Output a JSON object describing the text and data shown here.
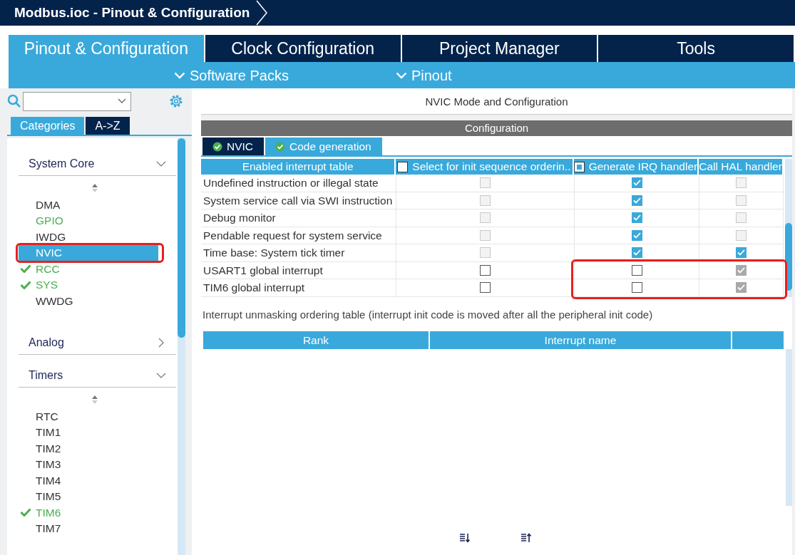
{
  "window": {
    "title": "Modbus.ioc - Pinout & Configuration"
  },
  "main_tabs": [
    {
      "label": "Pinout & Configuration",
      "selected": true
    },
    {
      "label": "Clock Configuration",
      "selected": false
    },
    {
      "label": "Project Manager",
      "selected": false
    },
    {
      "label": "Tools",
      "selected": false
    }
  ],
  "sub_menu": [
    "Software Packs",
    "Pinout"
  ],
  "sidebar": {
    "view_tabs": [
      {
        "label": "Categories",
        "selected": true
      },
      {
        "label": "A->Z",
        "selected": false
      }
    ],
    "categories": [
      {
        "label": "System Core",
        "expanded": true,
        "items": [
          {
            "label": "DMA",
            "configured": false,
            "checked": false,
            "selected": false,
            "annotated": false
          },
          {
            "label": "GPIO",
            "configured": true,
            "checked": false,
            "selected": false,
            "annotated": false
          },
          {
            "label": "IWDG",
            "configured": false,
            "checked": false,
            "selected": false,
            "annotated": false
          },
          {
            "label": "NVIC",
            "configured": false,
            "checked": false,
            "selected": true,
            "annotated": true
          },
          {
            "label": "RCC",
            "configured": true,
            "checked": true,
            "selected": false,
            "annotated": false
          },
          {
            "label": "SYS",
            "configured": true,
            "checked": true,
            "selected": false,
            "annotated": false
          },
          {
            "label": "WWDG",
            "configured": false,
            "checked": false,
            "selected": false,
            "annotated": false
          }
        ]
      },
      {
        "label": "Analog",
        "expanded": false
      },
      {
        "label": "Timers",
        "expanded": true,
        "items": [
          {
            "label": "RTC",
            "configured": false,
            "checked": false,
            "selected": false,
            "annotated": false
          },
          {
            "label": "TIM1",
            "configured": false,
            "checked": false,
            "selected": false,
            "annotated": false
          },
          {
            "label": "TIM2",
            "configured": false,
            "checked": false,
            "selected": false,
            "annotated": false
          },
          {
            "label": "TIM3",
            "configured": false,
            "checked": false,
            "selected": false,
            "annotated": false
          },
          {
            "label": "TIM4",
            "configured": false,
            "checked": false,
            "selected": false,
            "annotated": false
          },
          {
            "label": "TIM5",
            "configured": false,
            "checked": false,
            "selected": false,
            "annotated": false
          },
          {
            "label": "TIM6",
            "configured": true,
            "checked": true,
            "selected": false,
            "annotated": false
          },
          {
            "label": "TIM7",
            "configured": false,
            "checked": false,
            "selected": false,
            "annotated": false
          }
        ]
      }
    ]
  },
  "panel": {
    "title": "NVIC Mode and Configuration",
    "section": "Configuration",
    "tabs": [
      {
        "label": "NVIC",
        "selected": false
      },
      {
        "label": "Code generation",
        "selected": true
      }
    ],
    "interrupt_table": {
      "columns": [
        {
          "label": "Enabled interrupt table"
        },
        {
          "label": "Select for init sequence orderin..",
          "header_checkbox": {
            "mixed": false
          }
        },
        {
          "label": "Generate IRQ handler",
          "header_checkbox": {
            "mixed": true
          }
        },
        {
          "label": "Call HAL handler"
        }
      ],
      "rows": [
        {
          "name": "Undefined instruction or illegal state",
          "annotated": false,
          "checks": [
            {
              "checked": false,
              "disabled": true
            },
            {
              "checked": true,
              "disabled": false
            },
            {
              "checked": false,
              "disabled": true
            }
          ]
        },
        {
          "name": "System service call via SWI instruction",
          "annotated": false,
          "checks": [
            {
              "checked": false,
              "disabled": true
            },
            {
              "checked": true,
              "disabled": false
            },
            {
              "checked": false,
              "disabled": true
            }
          ]
        },
        {
          "name": "Debug monitor",
          "annotated": false,
          "checks": [
            {
              "checked": false,
              "disabled": true
            },
            {
              "checked": true,
              "disabled": false
            },
            {
              "checked": false,
              "disabled": true
            }
          ]
        },
        {
          "name": "Pendable request for system service",
          "annotated": false,
          "checks": [
            {
              "checked": false,
              "disabled": true
            },
            {
              "checked": true,
              "disabled": false
            },
            {
              "checked": false,
              "disabled": true
            }
          ]
        },
        {
          "name": "Time base: System tick timer",
          "annotated": false,
          "checks": [
            {
              "checked": false,
              "disabled": true
            },
            {
              "checked": true,
              "disabled": false
            },
            {
              "checked": true,
              "disabled": false
            }
          ]
        },
        {
          "name": "USART1 global interrupt",
          "annotated": true,
          "checks": [
            {
              "checked": false,
              "disabled": false
            },
            {
              "checked": false,
              "disabled": false
            },
            {
              "checked": true,
              "disabled": true
            }
          ]
        },
        {
          "name": "TIM6 global interrupt",
          "annotated": true,
          "checks": [
            {
              "checked": false,
              "disabled": false
            },
            {
              "checked": false,
              "disabled": false
            },
            {
              "checked": true,
              "disabled": true
            }
          ]
        }
      ]
    },
    "ordering_note": "Interrupt unmasking ordering table (interrupt init code is moved after all the peripheral init code)",
    "ordering_table": {
      "columns": [
        "Rank",
        "Interrupt name"
      ]
    }
  }
}
